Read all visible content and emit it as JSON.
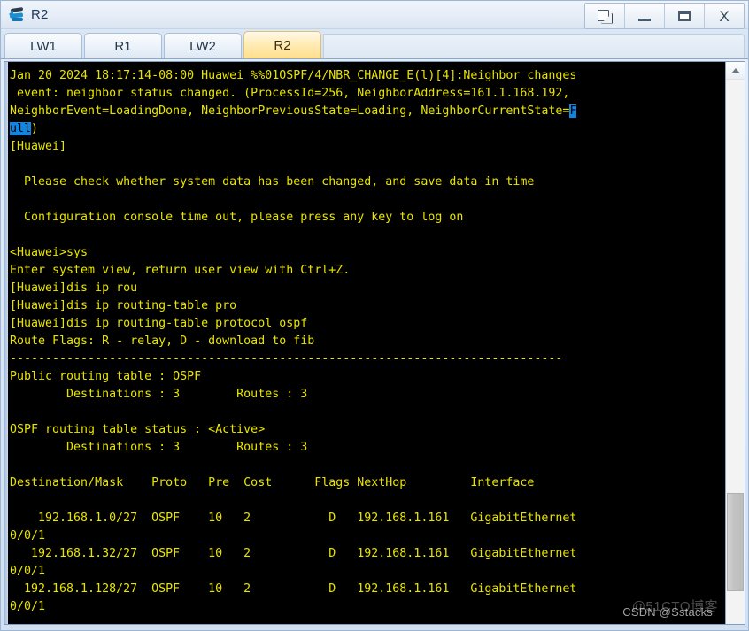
{
  "window": {
    "title": "R2",
    "app_icon": "router-icon",
    "controls": [
      {
        "name": "restore-window-button",
        "icon": "restore-icon",
        "label": ""
      },
      {
        "name": "minimize-window-button",
        "icon": "minimize-icon",
        "label": ""
      },
      {
        "name": "maximize-window-button",
        "icon": "maximize-icon",
        "label": ""
      },
      {
        "name": "close-window-button",
        "icon": "close-icon",
        "label": "X"
      }
    ]
  },
  "tabs": [
    {
      "label": "LW1",
      "active": false
    },
    {
      "label": "R1",
      "active": false
    },
    {
      "label": "LW2",
      "active": false
    },
    {
      "label": "R2",
      "active": true
    }
  ],
  "terminal": {
    "foreground_color": "#e8e400",
    "background_color": "#000000",
    "selection_bg": "#1186e0",
    "selection_fg": "#000000",
    "lines": [
      {
        "id": "l01",
        "segments": [
          {
            "t": "Jan 20 2024 18:17:14-08:00 Huawei %%01OSPF/4/NBR_CHANGE_E(l)[4]:Neighbor changes",
            "sel": false
          }
        ]
      },
      {
        "id": "l02",
        "segments": [
          {
            "t": " event: neighbor status changed. (ProcessId=256, NeighborAddress=161.1.168.192,",
            "sel": false
          }
        ]
      },
      {
        "id": "l03",
        "segments": [
          {
            "t": "NeighborEvent=LoadingDone, NeighborPreviousState=Loading, NeighborCurrentState=",
            "sel": false
          },
          {
            "t": "F",
            "sel": true
          }
        ]
      },
      {
        "id": "l04",
        "segments": [
          {
            "t": "ull",
            "sel": true
          },
          {
            "t": ")",
            "sel": false
          }
        ]
      },
      {
        "id": "l05",
        "segments": [
          {
            "t": "[Huawei]",
            "sel": false
          }
        ]
      },
      {
        "id": "l06",
        "segments": [
          {
            "t": "",
            "sel": false
          }
        ]
      },
      {
        "id": "l07",
        "segments": [
          {
            "t": "  Please check whether system data has been changed, and save data in time",
            "sel": false
          }
        ]
      },
      {
        "id": "l08",
        "segments": [
          {
            "t": "",
            "sel": false
          }
        ]
      },
      {
        "id": "l09",
        "segments": [
          {
            "t": "  Configuration console time out, please press any key to log on",
            "sel": false
          }
        ]
      },
      {
        "id": "l10",
        "segments": [
          {
            "t": "",
            "sel": false
          }
        ]
      },
      {
        "id": "l11",
        "segments": [
          {
            "t": "<Huawei>sys",
            "sel": false
          }
        ]
      },
      {
        "id": "l12",
        "segments": [
          {
            "t": "Enter system view, return user view with Ctrl+Z.",
            "sel": false
          }
        ]
      },
      {
        "id": "l13",
        "segments": [
          {
            "t": "[Huawei]dis ip rou",
            "sel": false
          }
        ]
      },
      {
        "id": "l14",
        "segments": [
          {
            "t": "[Huawei]dis ip routing-table pro",
            "sel": false
          }
        ]
      },
      {
        "id": "l15",
        "segments": [
          {
            "t": "[Huawei]dis ip routing-table protocol ospf",
            "sel": false
          }
        ]
      },
      {
        "id": "l16",
        "segments": [
          {
            "t": "Route Flags: R - relay, D - download to fib",
            "sel": false
          }
        ]
      },
      {
        "id": "l17",
        "segments": [
          {
            "t": "------------------------------------------------------------------------------",
            "sel": false
          }
        ]
      },
      {
        "id": "l18",
        "segments": [
          {
            "t": "Public routing table : OSPF",
            "sel": false
          }
        ]
      },
      {
        "id": "l19",
        "segments": [
          {
            "t": "        Destinations : 3        Routes : 3",
            "sel": false
          }
        ]
      },
      {
        "id": "l20",
        "segments": [
          {
            "t": "",
            "sel": false
          }
        ]
      },
      {
        "id": "l21",
        "segments": [
          {
            "t": "OSPF routing table status : <Active>",
            "sel": false
          }
        ]
      },
      {
        "id": "l22",
        "segments": [
          {
            "t": "        Destinations : 3        Routes : 3",
            "sel": false
          }
        ]
      },
      {
        "id": "l23",
        "segments": [
          {
            "t": "",
            "sel": false
          }
        ]
      },
      {
        "id": "l24",
        "segments": [
          {
            "t": "Destination/Mask    Proto   Pre  Cost      Flags NextHop         Interface",
            "sel": false
          }
        ]
      },
      {
        "id": "l25",
        "segments": [
          {
            "t": "",
            "sel": false
          }
        ]
      },
      {
        "id": "l26",
        "segments": [
          {
            "t": "    192.168.1.0/27  OSPF    10   2           D   192.168.1.161   GigabitEthernet",
            "sel": false
          }
        ]
      },
      {
        "id": "l27",
        "segments": [
          {
            "t": "0/0/1",
            "sel": false
          }
        ]
      },
      {
        "id": "l28",
        "segments": [
          {
            "t": "   192.168.1.32/27  OSPF    10   2           D   192.168.1.161   GigabitEthernet",
            "sel": false
          }
        ]
      },
      {
        "id": "l29",
        "segments": [
          {
            "t": "0/0/1",
            "sel": false
          }
        ]
      },
      {
        "id": "l30",
        "segments": [
          {
            "t": "  192.168.1.128/27  OSPF    10   2           D   192.168.1.161   GigabitEthernet",
            "sel": false
          }
        ]
      },
      {
        "id": "l31",
        "segments": [
          {
            "t": "0/0/1",
            "sel": false
          }
        ]
      }
    ],
    "routing_table": {
      "flags_legend": "Route Flags: R - relay, D - download to fib",
      "public_table": "OSPF",
      "public_destinations": "3",
      "public_routes": "3",
      "ospf_status": "<Active>",
      "ospf_destinations": "3",
      "ospf_routes": "3",
      "columns": [
        "Destination/Mask",
        "Proto",
        "Pre",
        "Cost",
        "Flags",
        "NextHop",
        "Interface"
      ],
      "rows": [
        {
          "dest": "192.168.1.0/27",
          "proto": "OSPF",
          "pre": "10",
          "cost": "2",
          "flags": "D",
          "nexthop": "192.168.1.161",
          "interface": "GigabitEthernet0/0/1"
        },
        {
          "dest": "192.168.1.32/27",
          "proto": "OSPF",
          "pre": "10",
          "cost": "2",
          "flags": "D",
          "nexthop": "192.168.1.161",
          "interface": "GigabitEthernet0/0/1"
        },
        {
          "dest": "192.168.1.128/27",
          "proto": "OSPF",
          "pre": "10",
          "cost": "2",
          "flags": "D",
          "nexthop": "192.168.1.161",
          "interface": "GigabitEthernet0/0/1"
        }
      ]
    }
  },
  "scrollbar": {
    "up_arrow_icon": "chevron-up-icon",
    "thumb_top_percent": "76",
    "thumb_height_percent": "18"
  },
  "watermarks": {
    "primary": "@51CTO博客",
    "secondary": "CSDN @Sstacks"
  }
}
